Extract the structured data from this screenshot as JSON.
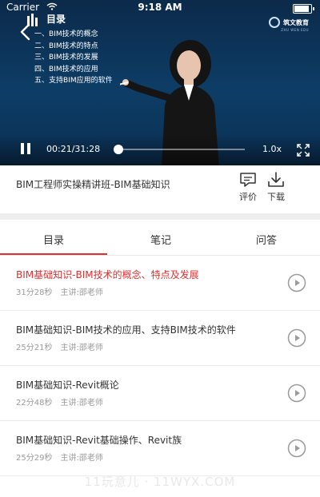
{
  "status_bar": {
    "carrier": "Carrier",
    "time": "9:18 AM"
  },
  "video": {
    "slide_title": "目录",
    "outline": [
      "一、BIM技术的概念",
      "二、BIM技术的特点",
      "三、BIM技术的发展",
      "四、BIM技术的应用",
      "五、支持BIM应用的软件"
    ],
    "brand_name": "筑文教育",
    "brand_sub": "ZHU WEN EDU",
    "current_time": "00:21",
    "duration": "31:28",
    "progress": 0.011,
    "speed": "1.0x"
  },
  "course": {
    "title": "BIM工程师实操精讲班-BIM基础知识",
    "rate_label": "评价",
    "download_label": "下载"
  },
  "tabs": [
    "目录",
    "笔记",
    "问答"
  ],
  "lessons": [
    {
      "title": "BIM基础知识-BIM技术的概念、特点及发展",
      "duration": "31分28秒",
      "teacher": "主讲:邵老师",
      "active": true
    },
    {
      "title": "BIM基础知识-BIM技术的应用、支持BIM技术的软件",
      "duration": "25分21秒",
      "teacher": "主讲:邵老师",
      "active": false
    },
    {
      "title": "BIM基础知识-Revit概论",
      "duration": "22分48秒",
      "teacher": "主讲:邵老师",
      "active": false
    },
    {
      "title": "BIM基础知识-Revit基础操作、Revit族",
      "duration": "25分29秒",
      "teacher": "主讲:邵老师",
      "active": false
    }
  ],
  "watermark": "11玩意儿 · 11WYX.COM",
  "colors": {
    "accent": "#e02f2f",
    "video_bg": "#0d3d66"
  }
}
